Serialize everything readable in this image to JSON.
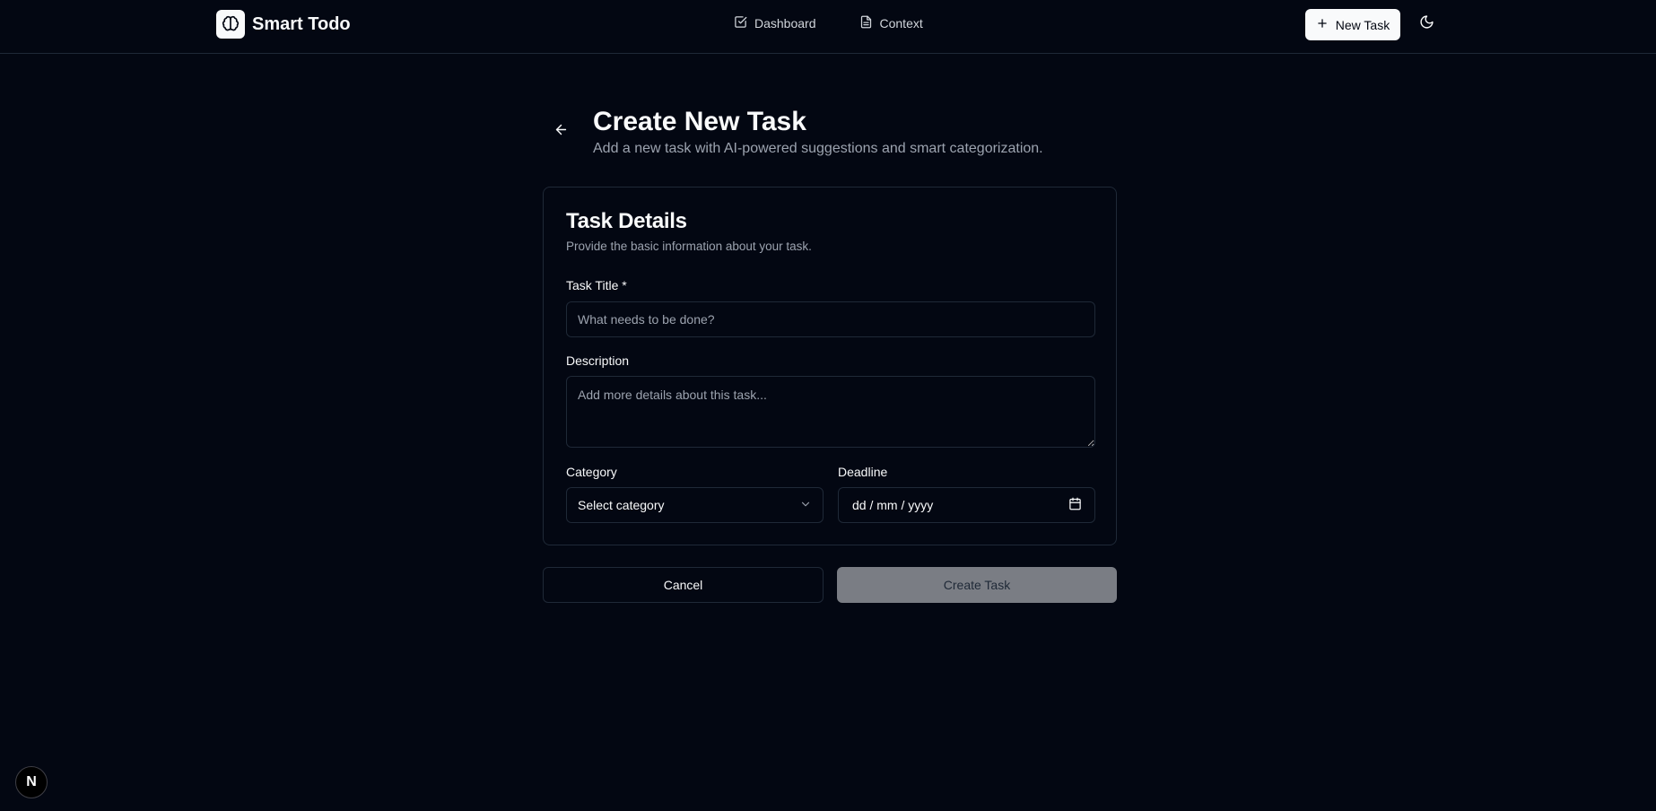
{
  "app": {
    "name": "Smart Todo",
    "logo_icon": "brain-icon"
  },
  "nav": {
    "items": [
      {
        "label": "Dashboard",
        "icon": "checkbox-icon"
      },
      {
        "label": "Context",
        "icon": "document-icon"
      }
    ]
  },
  "header": {
    "new_task_label": "New Task",
    "theme_icon": "moon-icon"
  },
  "page": {
    "title": "Create New Task",
    "subtitle": "Add a new task with AI-powered suggestions and smart categorization."
  },
  "form": {
    "card_title": "Task Details",
    "card_description": "Provide the basic information about your task.",
    "title_label": "Task Title *",
    "title_placeholder": "What needs to be done?",
    "description_label": "Description",
    "description_placeholder": "Add more details about this task...",
    "category_label": "Category",
    "category_value": "Select category",
    "deadline_label": "Deadline",
    "deadline_value": "dd / mm / yyyy"
  },
  "actions": {
    "cancel_label": "Cancel",
    "create_label": "Create Task"
  },
  "badge": {
    "letter": "N"
  },
  "colors": {
    "background": "#030712",
    "border": "#1f2937",
    "muted_text": "#9ca3af",
    "primary_button": "#f9fafb",
    "disabled_button": "#7a7d84"
  }
}
